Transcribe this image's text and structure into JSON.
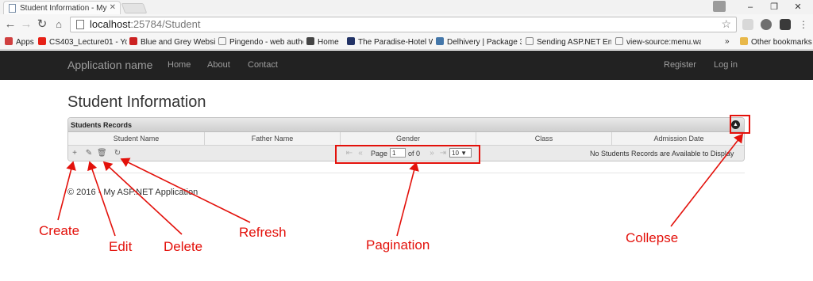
{
  "browser": {
    "tab_title": "Student Information - My",
    "url_host": "localhost",
    "url_path": ":25784/Student",
    "bookmarks_overflow": "»",
    "bookmarks": [
      {
        "label": "Apps",
        "color": "#d04040"
      },
      {
        "label": "CS403_Lecture01 - Yo",
        "color": "#e62117"
      },
      {
        "label": "Blue and Grey Websit",
        "color": "#cc2222"
      },
      {
        "label": "Pingendo - web autho",
        "color": "#888888"
      },
      {
        "label": "Home",
        "color": "#444444"
      },
      {
        "label": "The Paradise-Hotel W",
        "color": "#223366"
      },
      {
        "label": "Delhivery | Package 3",
        "color": "#4477aa"
      },
      {
        "label": "Sending ASP.NET Ema",
        "color": "#888888"
      },
      {
        "label": "view-source:menu.wa",
        "color": "#888888"
      },
      {
        "label": "Other bookmarks",
        "color": "#e8b84a"
      }
    ]
  },
  "navbar": {
    "brand": "Application name",
    "links": [
      "Home",
      "About",
      "Contact"
    ],
    "right_links": [
      "Register",
      "Log in"
    ]
  },
  "page": {
    "title": "Student Information",
    "footer": "© 2016 - My ASP.NET Application"
  },
  "grid": {
    "caption": "Students Records",
    "columns": [
      "Student Name",
      "Father Name",
      "Gender",
      "Class",
      "Admission Date"
    ],
    "pager": {
      "page_label": "Page",
      "page_value": "1",
      "of_label": "of 0",
      "rows_per_page": "10 ▼",
      "empty_message": "No Students Records are Available to Display"
    }
  },
  "annotations": {
    "color": "#e3110b",
    "labels": [
      "Create",
      "Edit",
      "Delete",
      "Refresh",
      "Pagination",
      "Collepse"
    ]
  }
}
